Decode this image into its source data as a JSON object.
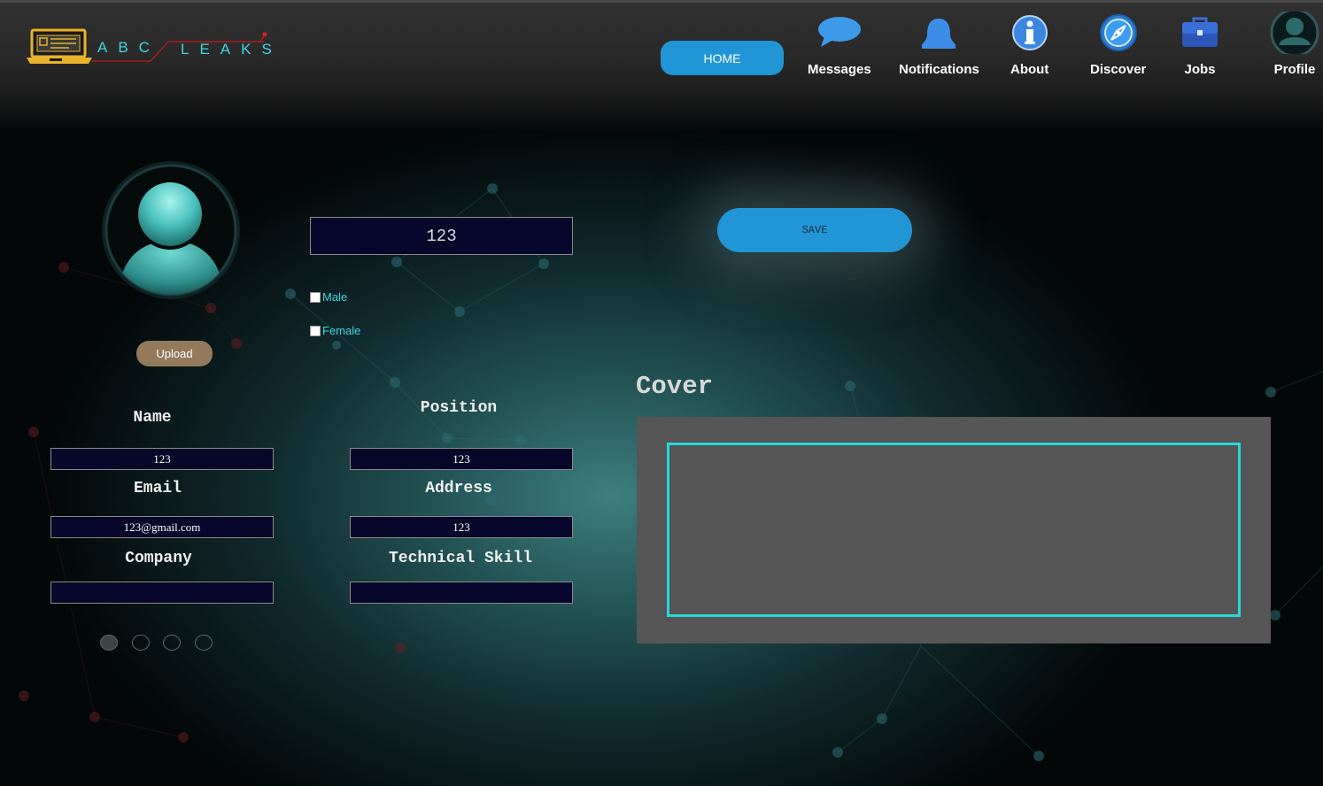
{
  "header": {
    "logo_left": "ABC",
    "logo_right": "LEAKS",
    "home_label": "HOME",
    "nav": [
      {
        "label": "Messages",
        "icon": "speech-bubble-icon"
      },
      {
        "label": "Notifications",
        "icon": "bell-icon"
      },
      {
        "label": "About",
        "icon": "info-icon"
      },
      {
        "label": "Discover",
        "icon": "compass-icon"
      },
      {
        "label": "Jobs",
        "icon": "briefcase-icon"
      },
      {
        "label": "Profile",
        "icon": "user-avatar-icon"
      }
    ]
  },
  "profile": {
    "upload_label": "Upload",
    "top_field_value": "123",
    "gender_options": [
      {
        "label": "Male",
        "checked": false
      },
      {
        "label": "Female",
        "checked": false
      }
    ],
    "save_label": "SAVE"
  },
  "form": {
    "name": {
      "label": "Name",
      "value": "123"
    },
    "position": {
      "label": "Position",
      "value": "123"
    },
    "email": {
      "label": "Email",
      "value": "123@gmail.com"
    },
    "address": {
      "label": "Address",
      "value": "123"
    },
    "company": {
      "label": "Company",
      "value": ""
    },
    "technical_skill": {
      "label": "Technical Skill",
      "value": ""
    }
  },
  "pager": {
    "dots": 4
  },
  "cover": {
    "title": "Cover"
  },
  "colors": {
    "accent_blue": "#2196d6",
    "cyan": "#27d8de",
    "input_bg": "#06072a",
    "upload_bg": "#937a5c",
    "panel_gray": "#565656"
  }
}
